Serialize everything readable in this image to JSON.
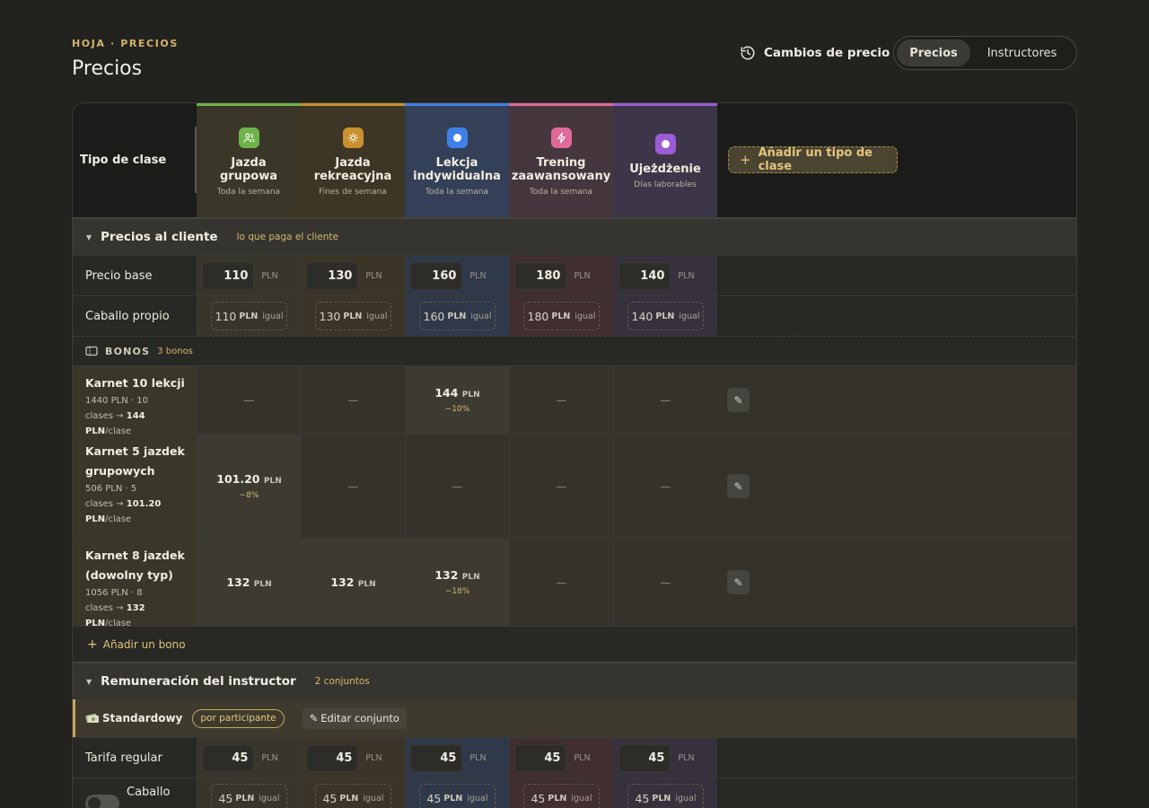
{
  "header": {
    "breadcrumb": "HOJA · PRECIOS",
    "title": "Precios",
    "history_label": "Cambios de precio",
    "tabs": [
      {
        "label": "Precios",
        "active": true
      },
      {
        "label": "Instructores",
        "active": false
      }
    ]
  },
  "class_header": {
    "label": "Tipo de clase",
    "add_label": "Añadir un tipo de clase",
    "columns": [
      {
        "name": "Jazda grupowa",
        "sub": "Toda la semana",
        "icon": "users-icon",
        "color": "#6cb44a"
      },
      {
        "name": "Jazda rekreacyjna",
        "sub": "Fines de semana",
        "icon": "sun-icon",
        "color": "#c9902e"
      },
      {
        "name": "Lekcja indywidualna",
        "sub": "Toda la semana",
        "icon": "circle-icon",
        "color": "#3f7fe8"
      },
      {
        "name": "Trening zaawansowany",
        "sub": "Toda la semana",
        "icon": "bolt-icon",
        "color": "#e06a9a"
      },
      {
        "name": "Ujeżdżenie",
        "sub": "Días laborables",
        "icon": "circle-icon",
        "color": "#9b5cd6"
      }
    ]
  },
  "client": {
    "title": "Precios al cliente",
    "note": "lo que paga el cliente",
    "unit": "PLN",
    "equal": "igual",
    "base_label": "Precio base",
    "base": [
      "110",
      "130",
      "160",
      "180",
      "140"
    ],
    "own_label": "Caballo propio",
    "own": [
      "110",
      "130",
      "160",
      "180",
      "140"
    ]
  },
  "bonos": {
    "title": "BONOS",
    "count": "3 bonos",
    "add_label": "Añadir un bono",
    "items": [
      {
        "name": "Karnet 10 lekcji",
        "detail_a": "1440 PLN · 10",
        "detail_b": "clases →",
        "detail_price": "144 PLN",
        "detail_c": "/clase",
        "values": [
          null,
          null,
          {
            "v": "144",
            "d": "−10%"
          },
          null,
          null
        ]
      },
      {
        "name": "Karnet 5 jazdek grupowych",
        "detail_a": "506 PLN · 5",
        "detail_b": "clases →",
        "detail_price": "101.20 PLN",
        "detail_c": "/clase",
        "values": [
          {
            "v": "101.20",
            "d": "−8%"
          },
          null,
          null,
          null,
          null
        ]
      },
      {
        "name": "Karnet 8 jazdek (dowolny typ)",
        "detail_a": "1056 PLN · 8",
        "detail_b": "clases →",
        "detail_price": "132 PLN",
        "detail_c": "/clase",
        "values": [
          {
            "v": "132",
            "d": ""
          },
          {
            "v": "132",
            "d": ""
          },
          {
            "v": "132",
            "d": "−18%"
          },
          null,
          null
        ]
      }
    ]
  },
  "instructor": {
    "title": "Remuneración del instructor",
    "count": "2 conjuntos",
    "set_name": "Standardowy",
    "set_badge": "por participante",
    "set_edit": "Editar conjunto",
    "regular_label": "Tarifa regular",
    "regular": [
      "45",
      "45",
      "45",
      "45",
      "45"
    ],
    "own_label": "Caballo",
    "own": [
      "45",
      "45",
      "45",
      "45",
      "45"
    ]
  },
  "dash": "—",
  "colors": {
    "accent": "#d4b46a",
    "background": "#22221e"
  }
}
